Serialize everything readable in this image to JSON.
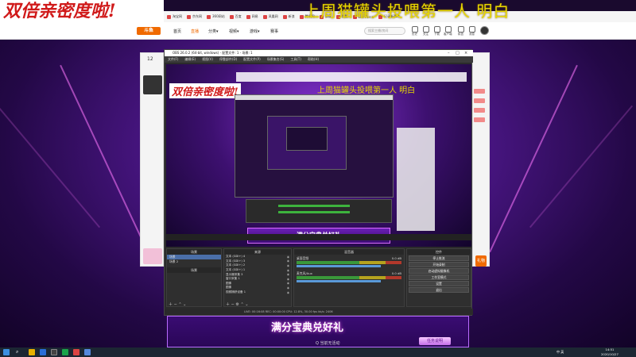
{
  "overlay": {
    "left_banner": "双倍亲密度啦!",
    "right_banner": "上周猫罐头投喂第一人 明白"
  },
  "browser": {
    "bookmarks": [
      "淘宝网",
      "京东网",
      "360网站",
      "百度",
      "网易",
      "凤凰网",
      "新浪",
      "腾讯网",
      "搜狐",
      "优酷",
      "Life Force",
      "记录新事件"
    ]
  },
  "site_nav": {
    "logo_text": "斗鱼",
    "items": [
      "首页",
      "直播",
      "分类▾",
      "视频▾",
      "游戏▾",
      "赛事"
    ],
    "search_placeholder": "搜索主播/房间",
    "header_labels": [
      "历史",
      "关注",
      "下载",
      "客户端",
      "私信",
      "消息"
    ]
  },
  "stage": {
    "fan_count": "12",
    "gift_label": "礼物"
  },
  "obs": {
    "title": "OBS 26.0.2 (64-bit, windows) - 配置文件: 1 - 场景: 1",
    "menu": [
      "文件(F)",
      "编辑(E)",
      "视图(V)",
      "停靠部件(D)",
      "配置文件(P)",
      "场景集合(S)",
      "工具(T)",
      "帮助(H)"
    ],
    "inner_left_banner": "双倍亲密度啦!",
    "inner_right_banner": "上周猫罐头投喂第一人 明白",
    "promo_text": "满分宝典兑好礼",
    "scene_label": "场景",
    "scenes_header": "场景",
    "scenes": [
      "场景",
      "场景 2"
    ],
    "sources_header": "来源",
    "sources": [
      "文本 (GDI+) 4",
      "文本 (GDI+) 3",
      "文本 (GDI+) 2",
      "文本 (GDI+) 1",
      "显示器采集 3",
      "窗口采集 1",
      "图像",
      "图像",
      "视频捕获设备 1"
    ],
    "mixer_header": "混音器",
    "mixer": [
      {
        "label": "桌面音频",
        "db": "0.0 dB"
      },
      {
        "label": "麦克风/Aux",
        "db": "0.0 dB"
      }
    ],
    "controls_header": "控件",
    "controls": [
      "停止推流",
      "开始录制",
      "启动虚拟摄像机",
      "工作室模式",
      "设置",
      "退出"
    ],
    "status": "LIVE: 00:16:08   REC: 00:00:00   CPU: 12.8%, 30.00 fps   kb/s: 2406"
  },
  "page": {
    "promo_title": "满分宝典兑好礼",
    "promo_sub": "Q 当前无活动",
    "task_button": "任务说明"
  },
  "taskbar": {
    "tray_text": "中 英",
    "time": "14:51",
    "date": "2020/10/27"
  }
}
